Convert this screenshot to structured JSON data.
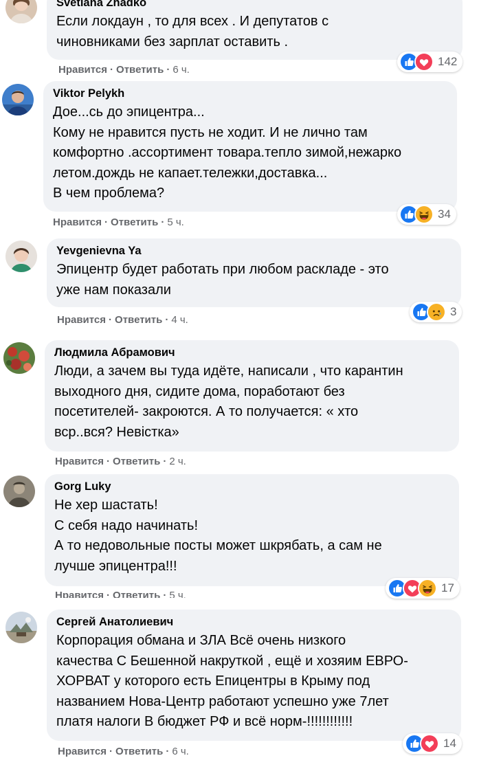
{
  "colors": {
    "bubble": "#f0f2f5",
    "meta_text": "#65676b",
    "like_blue": "#1877f2",
    "love_red": "#f33e58",
    "haha_yellow": "#f7b125"
  },
  "action_labels": {
    "like": "Нравится",
    "reply": "Ответить",
    "separator": "·"
  },
  "comments": [
    {
      "author": "Svetlana Zhadko",
      "text": "Если локдаун , то для всех . И депутатов с\nчиновниками без зарплат оставить .",
      "time": "6 ч.",
      "reactions": [
        "like-icon",
        "love-icon"
      ],
      "reaction_count": "142"
    },
    {
      "author": "Viktor Pelykh",
      "text": "Дое...сь до эпицентра...\nКому не нравится пусть не ходит. И не лично там\nкомфортно .ассортимент товара.тепло зимой,нежарко\nлетом.дождь не капает.тележки,доставка...\nВ чем проблема?",
      "time": "5 ч.",
      "reactions": [
        "like-icon",
        "haha-icon"
      ],
      "reaction_count": "34"
    },
    {
      "author": "Yevgenievna Ya",
      "text": "Эпицентр будет работать при любом раскладе - это\nуже нам показали",
      "time": "4 ч.",
      "reactions": [
        "like-icon",
        "sad-icon"
      ],
      "reaction_count": "3"
    },
    {
      "author": "Людмила Абрамович",
      "text": "Люди, а зачем вы туда идёте, написали , что карантин\nвыходного дня, сидите дома, поработают без\nпосетителей- закроются. А то получается: « хто\nвср..вся? Невістка»",
      "time": "2 ч.",
      "reactions": [],
      "reaction_count": ""
    },
    {
      "author": "Gorg Luky",
      "text": "Не хер шастать!\nС себя надо начинать!\nА то недовольные посты может шкрябать, а сам не\nлучше эпицентра!!!",
      "time": "5 ч.",
      "reactions": [
        "like-icon",
        "love-icon",
        "haha-icon"
      ],
      "reaction_count": "17"
    },
    {
      "author": "Сергей Анатолиевич",
      "text": "Корпорация обмана и ЗЛА Всё очень низкого\nкачества С Бешенной накруткой , ещё и хозяим ЕВРО-\nХОРВАТ у которого есть Епицентры в Крыму под\nназванием Нова-Центр работают успешно уже 7лет\nплатя налоги В бюджет РФ и всё норм-!!!!!!!!!!!!",
      "time": "6 ч.",
      "reactions": [
        "like-icon",
        "love-icon"
      ],
      "reaction_count": "14"
    }
  ]
}
